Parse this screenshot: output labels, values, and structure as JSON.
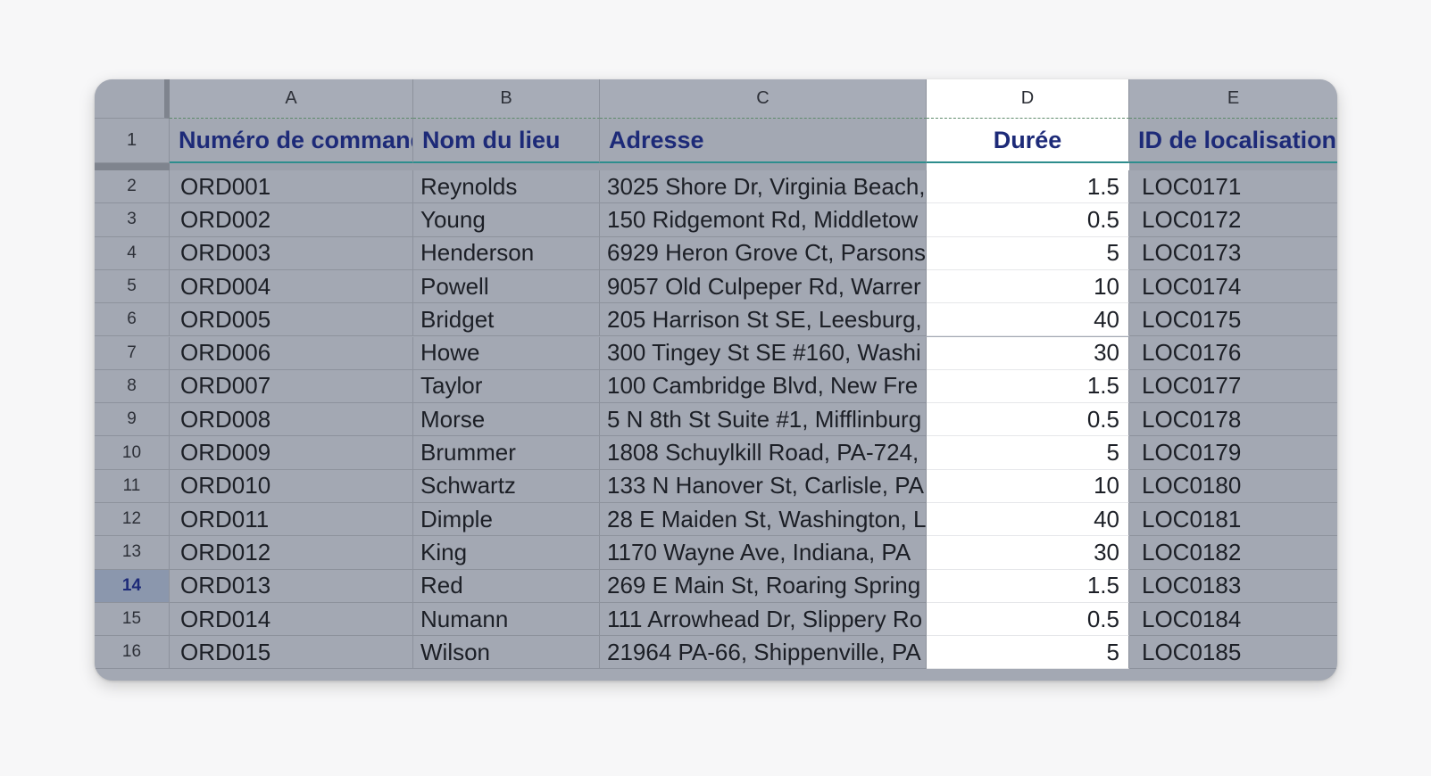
{
  "columns": [
    "A",
    "B",
    "C",
    "D",
    "E"
  ],
  "header_row": {
    "row_number": "1",
    "cells": [
      "Numéro de commande",
      "Nom du lieu",
      "Adresse",
      "Durée",
      "ID de localisation"
    ]
  },
  "selected_column": "D",
  "active_row": "14",
  "rows": [
    {
      "n": "2",
      "order": "ORD001",
      "name": "Reynolds",
      "address": "3025 Shore Dr, Virginia Beach,",
      "duration": "1.5",
      "loc": "LOC0171"
    },
    {
      "n": "3",
      "order": "ORD002",
      "name": "Young",
      "address": "150 Ridgemont Rd, Middletow",
      "duration": "0.5",
      "loc": "LOC0172"
    },
    {
      "n": "4",
      "order": "ORD003",
      "name": "Henderson",
      "address": "6929 Heron Grove Ct, Parsons",
      "duration": "5",
      "loc": "LOC0173"
    },
    {
      "n": "5",
      "order": "ORD004",
      "name": "Powell",
      "address": "9057 Old Culpeper Rd, Warrer",
      "duration": "10",
      "loc": "LOC0174"
    },
    {
      "n": "6",
      "order": "ORD005",
      "name": "Bridget",
      "address": "205 Harrison St SE, Leesburg,",
      "duration": "40",
      "loc": "LOC0175"
    },
    {
      "n": "7",
      "order": "ORD006",
      "name": "Howe",
      "address": "300 Tingey St SE #160, Washi",
      "duration": "30",
      "loc": "LOC0176"
    },
    {
      "n": "8",
      "order": "ORD007",
      "name": "Taylor",
      "address": "100 Cambridge Blvd, New Fre",
      "duration": "1.5",
      "loc": "LOC0177"
    },
    {
      "n": "9",
      "order": "ORD008",
      "name": "Morse",
      "address": "5 N 8th St Suite #1, Mifflinburg",
      "duration": "0.5",
      "loc": "LOC0178"
    },
    {
      "n": "10",
      "order": "ORD009",
      "name": "Brummer",
      "address": "1808 Schuylkill Road, PA-724,",
      "duration": "5",
      "loc": "LOC0179"
    },
    {
      "n": "11",
      "order": "ORD010",
      "name": "Schwartz",
      "address": "133 N Hanover St, Carlisle, PA",
      "duration": "10",
      "loc": "LOC0180"
    },
    {
      "n": "12",
      "order": "ORD011",
      "name": "Dimple",
      "address": "28 E Maiden St, Washington, L",
      "duration": "40",
      "loc": "LOC0181"
    },
    {
      "n": "13",
      "order": "ORD012",
      "name": "King",
      "address": "1170 Wayne Ave, Indiana, PA",
      "duration": "30",
      "loc": "LOC0182"
    },
    {
      "n": "14",
      "order": "ORD013",
      "name": "Red",
      "address": "269 E Main St, Roaring Spring",
      "duration": "1.5",
      "loc": "LOC0183"
    },
    {
      "n": "15",
      "order": "ORD014",
      "name": "Numann",
      "address": "111 Arrowhead Dr, Slippery Ro",
      "duration": "0.5",
      "loc": "LOC0184"
    },
    {
      "n": "16",
      "order": "ORD015",
      "name": "Wilson",
      "address": "21964 PA-66, Shippenville, PA",
      "duration": "5",
      "loc": "LOC0185"
    }
  ]
}
